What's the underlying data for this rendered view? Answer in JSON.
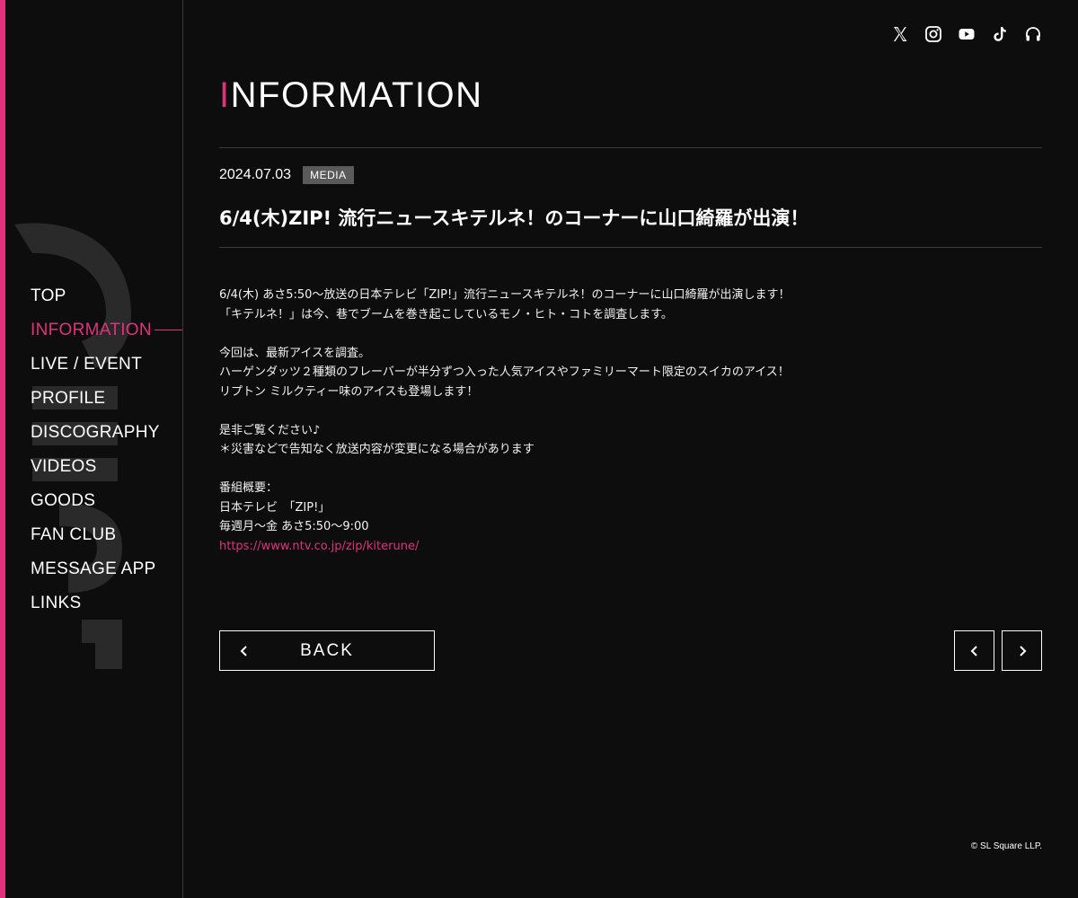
{
  "sidebar": {
    "nav": [
      {
        "label": "TOP",
        "active": false
      },
      {
        "label": "INFORMATION",
        "active": true
      },
      {
        "label": "LIVE / EVENT",
        "active": false
      },
      {
        "label": "PROFILE",
        "active": false
      },
      {
        "label": "DISCOGRAPHY",
        "active": false
      },
      {
        "label": "VIDEOS",
        "active": false
      },
      {
        "label": "GOODS",
        "active": false
      },
      {
        "label": "FAN CLUB",
        "active": false
      },
      {
        "label": "MESSAGE APP",
        "active": false
      },
      {
        "label": "LINKS",
        "active": false
      }
    ]
  },
  "social": [
    "x-icon",
    "instagram-icon",
    "youtube-icon",
    "tiktok-icon",
    "headphones-icon"
  ],
  "page": {
    "title_first": "I",
    "title_rest": "NFORMATION"
  },
  "article": {
    "date": "2024.07.03",
    "category": "MEDIA",
    "headline": "6/4(木)ZIP! 流行ニュースキテルネ！のコーナーに山口綺羅が出演！",
    "paragraphs": [
      [
        "6/4(木) あさ5:50〜放送の日本テレビ「ZIP!」流行ニュースキテルネ！のコーナーに山口綺羅が出演します！",
        "「キテルネ！」は今、巷でブームを巻き起こしているモノ・ヒト・コトを調査します。"
      ],
      [
        "今回は、最新アイスを調査。",
        "ハーゲンダッツ２種類のフレーバーが半分ずつ入った人気アイスやファミリーマート限定のスイカのアイス！",
        "リプトン ミルクティー味のアイスも登場します！"
      ],
      [
        "是非ご覧ください♪",
        "＊災害などで告知なく放送内容が変更になる場合があります"
      ],
      [
        "番組概要：",
        "日本テレビ　「ZIP!」",
        "毎週月〜金 あさ5:50〜9:00"
      ]
    ],
    "link": "https://www.ntv.co.jp/zip/kiterune/"
  },
  "buttons": {
    "back": "BACK"
  },
  "footer": {
    "copyright": "© SL Square LLP."
  },
  "colors": {
    "accent": "#e0327a",
    "background": "#0d0d0d",
    "badge": "#5a5a5a"
  }
}
